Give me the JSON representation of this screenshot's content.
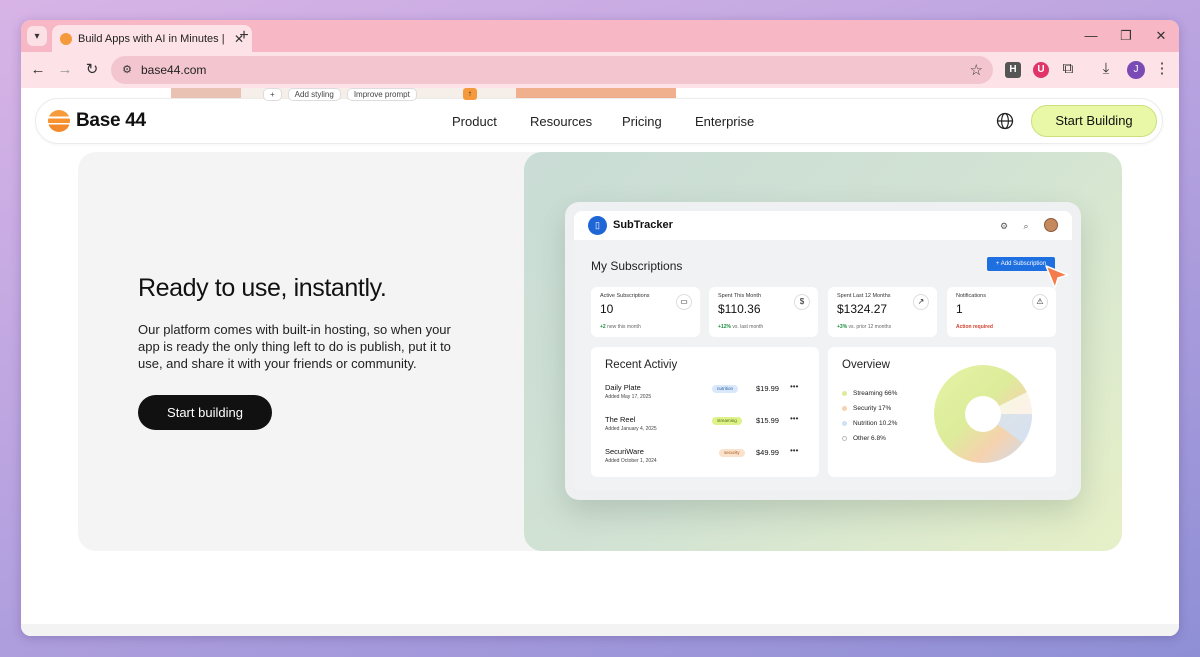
{
  "browser": {
    "tab_title": "Build Apps with AI in Minutes |",
    "tab_close": "✕",
    "new_tab": "+",
    "url": "base44.com",
    "window_controls": {
      "minimize": "—",
      "restore": "❐",
      "close": "✕"
    },
    "extensions": [
      {
        "name": "h-extension-icon",
        "label": "H",
        "color": "#555555"
      },
      {
        "name": "shield-extension-icon",
        "label": "U",
        "color": "#e0356a"
      }
    ],
    "profile_initial": "J"
  },
  "peek": {
    "chips": [
      "Add styling",
      "Improve prompt"
    ],
    "send": "↑",
    "plus": "+"
  },
  "site": {
    "logo_text": "Base 44",
    "nav": [
      "Product",
      "Resources",
      "Pricing",
      "Enterprise"
    ],
    "cta": "Start Building"
  },
  "hero": {
    "title": "Ready to use, instantly.",
    "body": "Our platform comes with built-in hosting, so when your app is ready the only thing left to do is publish, put it to use, and share it with your friends or community.",
    "button": "Start building"
  },
  "app": {
    "name": "SubTracker",
    "page_title": "My Subscriptions",
    "add_button": "+ Add Subscription",
    "stats": [
      {
        "label": "Active Subscriptions",
        "value": "10",
        "note_strong": "+2",
        "note": " new this month",
        "icon": "▭",
        "icon_name": "card-icon"
      },
      {
        "label": "Spent This Month",
        "value": "$110.36",
        "note_strong": "+12%",
        "note": " vs. last month",
        "icon": "$",
        "icon_name": "dollar-icon"
      },
      {
        "label": "Spent Last 12 Months",
        "value": "$1324.27",
        "note_strong": "+3%",
        "note": " vs. prior 12 months",
        "icon": "↗",
        "icon_name": "trend-up-icon"
      },
      {
        "label": "Notifications",
        "value": "1",
        "note_strong": "",
        "note": "Action required",
        "icon": "⚠",
        "icon_name": "warning-icon"
      }
    ],
    "recent": {
      "title": "Recent Activiy",
      "items": [
        {
          "name": "Daily Plate",
          "date": "Added May 17, 2025",
          "tag": "nutrition",
          "tag_color": "#d9e8fb",
          "tag_text": "#2f5f9e",
          "price": "$19.99"
        },
        {
          "name": "The Reel",
          "date": "Added January 4, 2025",
          "tag": "streaming",
          "tag_color": "#dff28a",
          "tag_text": "#4a6b10",
          "price": "$15.99"
        },
        {
          "name": "SecuriWare",
          "date": "Added October 1, 2024",
          "tag": "security",
          "tag_color": "#fbe2cc",
          "tag_text": "#a45a1e",
          "price": "$49.99"
        }
      ],
      "more": "•••"
    },
    "overview": {
      "title": "Overview",
      "legend": [
        {
          "label": "Streaming 66%",
          "color": "#dcec9a"
        },
        {
          "label": "Security 17%",
          "color": "#f6d2ae"
        },
        {
          "label": "Nutrition 10.2%",
          "color": "#cfe1f6"
        },
        {
          "label": "Other 6.8%",
          "color": "#ffffff"
        }
      ]
    }
  }
}
